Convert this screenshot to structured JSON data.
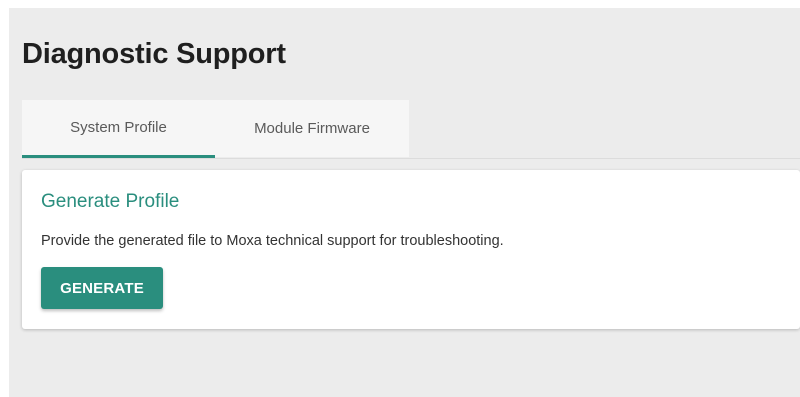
{
  "page": {
    "title": "Diagnostic Support"
  },
  "tabs": [
    {
      "label": "System Profile",
      "active": true
    },
    {
      "label": "Module Firmware",
      "active": false
    }
  ],
  "card": {
    "title": "Generate Profile",
    "description": "Provide the generated file to Moxa technical support for troubleshooting.",
    "button_label": "GENERATE"
  },
  "colors": {
    "accent": "#2a8e7e",
    "background": "#ececec",
    "card": "#ffffff"
  }
}
